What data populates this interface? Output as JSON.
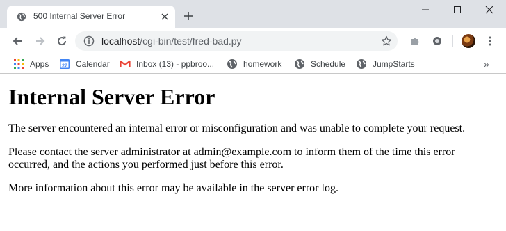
{
  "browser": {
    "tab": {
      "title": "500 Internal Server Error"
    },
    "address_bar": {
      "host": "localhost",
      "path": "/cgi-bin/test/fred-bad.py"
    },
    "bookmarks": [
      {
        "label": "Apps",
        "icon": "apps-grid-icon"
      },
      {
        "label": "Calendar",
        "icon": "calendar-icon"
      },
      {
        "label": "Inbox (13) - ppbroo...",
        "icon": "gmail-icon"
      },
      {
        "label": "homework",
        "icon": "globe-icon"
      },
      {
        "label": "Schedule",
        "icon": "globe-icon"
      },
      {
        "label": "JumpStarts",
        "icon": "globe-icon"
      }
    ],
    "bookmarks_overflow": "»",
    "colors": {
      "tabstrip": "#dee1e6",
      "omnibox": "#f1f3f4",
      "icon": "#5f6368"
    }
  },
  "page": {
    "heading": "Internal Server Error",
    "paragraphs": [
      "The server encountered an internal error or misconfiguration and was unable to complete your request.",
      "Please contact the server administrator at admin@example.com to inform them of the time this error occurred, and the actions you performed just before this error.",
      "More information about this error may be available in the server error log."
    ]
  }
}
